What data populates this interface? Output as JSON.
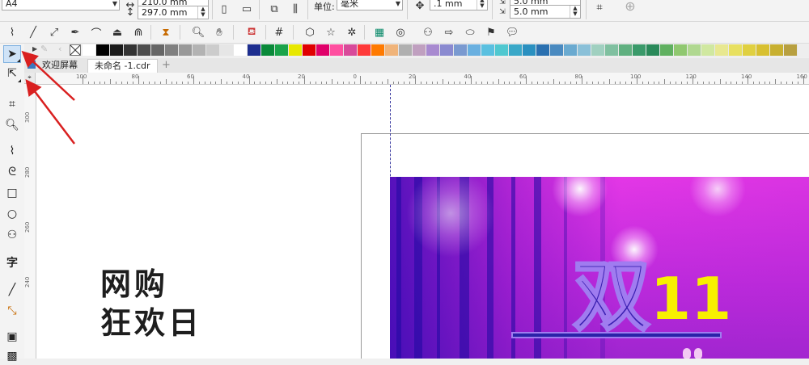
{
  "propbar": {
    "page_size": "A4",
    "width_value": "210.0 mm",
    "height_value": "297.0 mm",
    "unit_label": "单位:",
    "unit_value": "毫米",
    "nudge_value": ".1 mm",
    "dup_x_value": "5.0 mm",
    "dup_y_value": "5.0 mm"
  },
  "tabs": {
    "welcome": "欢迎屏幕",
    "doc": "未命名 -1.cdr",
    "add": "+"
  },
  "ruler": {
    "h_labels": [
      "100",
      "80",
      "60",
      "40",
      "20",
      "0",
      "20",
      "40",
      "60",
      "80",
      "100",
      "120",
      "140",
      "160"
    ],
    "v_labels": [
      "300",
      "280",
      "260",
      "240"
    ]
  },
  "canvas": {
    "headline_line1": "网购",
    "headline_line2": "狂欢日",
    "logo_shuang": "双",
    "logo_11": "11"
  },
  "palette": [
    "#ffffff",
    "#000000",
    "#1a1a1a",
    "#333333",
    "#4d4d4d",
    "#666666",
    "#808080",
    "#999999",
    "#b3b3b3",
    "#cccccc",
    "#e6e6e6",
    "#ffffff",
    "#1d2e8f",
    "#0a8a3a",
    "#1aa34a",
    "#e8e800",
    "#e00000",
    "#e0006a",
    "#ff4fa0",
    "#d84a9a",
    "#ff3a3a",
    "#ff7a00",
    "#f0b47a",
    "#b0b0b0",
    "#c0a0c0",
    "#a88ad0",
    "#8a8ad0",
    "#7a9ad0",
    "#6ab0e0",
    "#5ac0e0",
    "#50c8d0",
    "#3aa8c8",
    "#2a90c0",
    "#2a70b0",
    "#4a8ac0",
    "#6aaad0",
    "#8ac0d8",
    "#a0d0c0",
    "#80c0a0",
    "#60b080",
    "#3a9a6a",
    "#2a8a5a",
    "#60b060",
    "#90c870",
    "#b0d890",
    "#d0e8a0",
    "#e8e890",
    "#e8e060",
    "#e0d040",
    "#d8c030",
    "#c8b030",
    "#b8a040",
    "#a89050",
    "#c0a860",
    "#d8c070"
  ],
  "colors": {
    "accent_select": "#cfe3f7",
    "banner_pink": "#e63ce6",
    "banner_purple": "#3a1fb0",
    "logo_yellow": "#f8f000"
  }
}
